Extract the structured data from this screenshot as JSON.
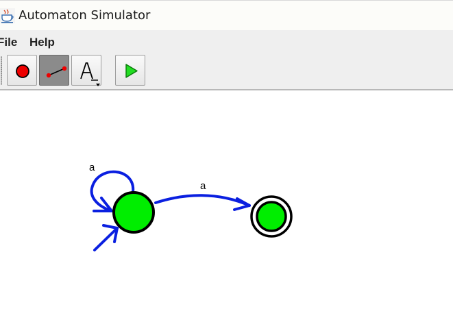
{
  "window": {
    "title": "Automaton Simulator",
    "app_icon": "java-cup-icon"
  },
  "menu": {
    "items": [
      "File",
      "Help"
    ]
  },
  "toolbar": {
    "tools": [
      {
        "name": "state-tool",
        "icon": "red-circle-icon",
        "selected": false
      },
      {
        "name": "transition-tool",
        "icon": "line-tool-icon",
        "selected": true
      },
      {
        "name": "text-tool",
        "icon": "letter-a-icon",
        "selected": false
      },
      {
        "name": "run-tool",
        "icon": "green-play-icon",
        "selected": false
      }
    ]
  },
  "automaton": {
    "states": [
      {
        "id": "q0",
        "initial": true,
        "accepting": false,
        "fill": "#00ee00"
      },
      {
        "id": "q1",
        "initial": false,
        "accepting": true,
        "fill": "#00ee00"
      }
    ],
    "transitions": [
      {
        "from": "q0",
        "to": "q0",
        "label": "a"
      },
      {
        "from": "q0",
        "to": "q1",
        "label": "a"
      }
    ],
    "colors": {
      "edge": "#0a1fe0",
      "state_fill": "#00ee00",
      "state_stroke": "#000000"
    }
  }
}
